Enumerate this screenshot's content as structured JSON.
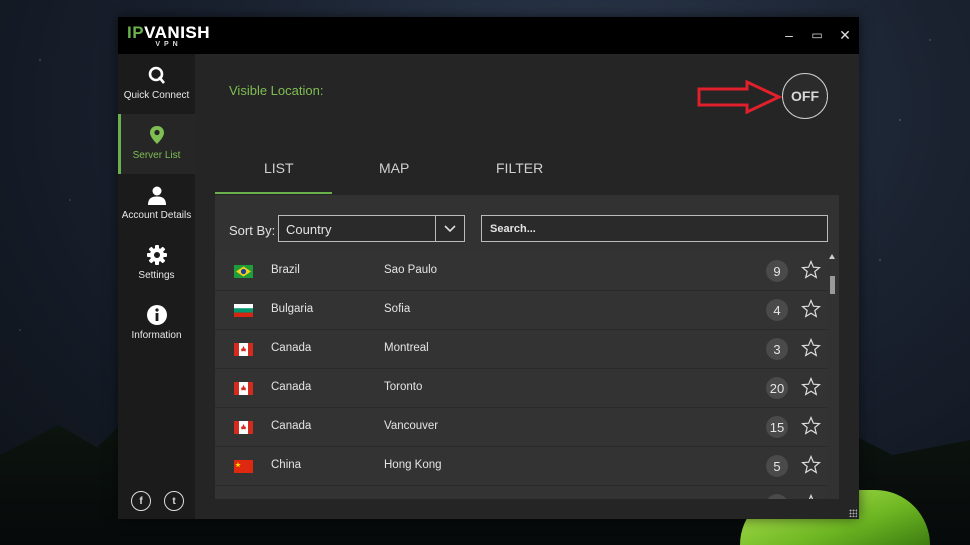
{
  "app": {
    "logo_main_ip": "IP",
    "logo_main_rest": "VANISH",
    "logo_sub": "VPN"
  },
  "window_controls": {
    "minimize": "–",
    "maximize": "▭",
    "close": "✕"
  },
  "sidebar": {
    "items": [
      {
        "label": "Quick Connect",
        "icon": "quick-connect-icon"
      },
      {
        "label": "Server List",
        "icon": "map-pin-icon",
        "active": true
      },
      {
        "label": "Account Details",
        "icon": "user-icon"
      },
      {
        "label": "Settings",
        "icon": "gear-icon"
      },
      {
        "label": "Information",
        "icon": "info-icon"
      }
    ],
    "social": {
      "facebook": "f",
      "twitter": "t"
    }
  },
  "header": {
    "visible_location_label": "Visible Location:",
    "connect_toggle": "OFF"
  },
  "tabs": [
    {
      "label": "LIST",
      "active": true
    },
    {
      "label": "MAP"
    },
    {
      "label": "FILTER"
    }
  ],
  "controls": {
    "sort_label": "Sort By:",
    "sort_value": "Country",
    "search_placeholder": "Search..."
  },
  "servers": [
    {
      "country": "Brazil",
      "city": "Sao Paulo",
      "count": "9",
      "flag": "brazil"
    },
    {
      "country": "Bulgaria",
      "city": "Sofia",
      "count": "4",
      "flag": "bulgaria"
    },
    {
      "country": "Canada",
      "city": "Montreal",
      "count": "3",
      "flag": "canada"
    },
    {
      "country": "Canada",
      "city": "Toronto",
      "count": "20",
      "flag": "canada"
    },
    {
      "country": "Canada",
      "city": "Vancouver",
      "count": "15",
      "flag": "canada"
    },
    {
      "country": "China",
      "city": "Hong Kong",
      "count": "5",
      "flag": "china"
    },
    {
      "country": "",
      "city": "",
      "count": "",
      "flag": "partial"
    }
  ],
  "colors": {
    "accent": "#6ab04c",
    "background": "#252525",
    "sidebar": "#1b1b1b",
    "annotation_arrow": "#e0202a"
  }
}
